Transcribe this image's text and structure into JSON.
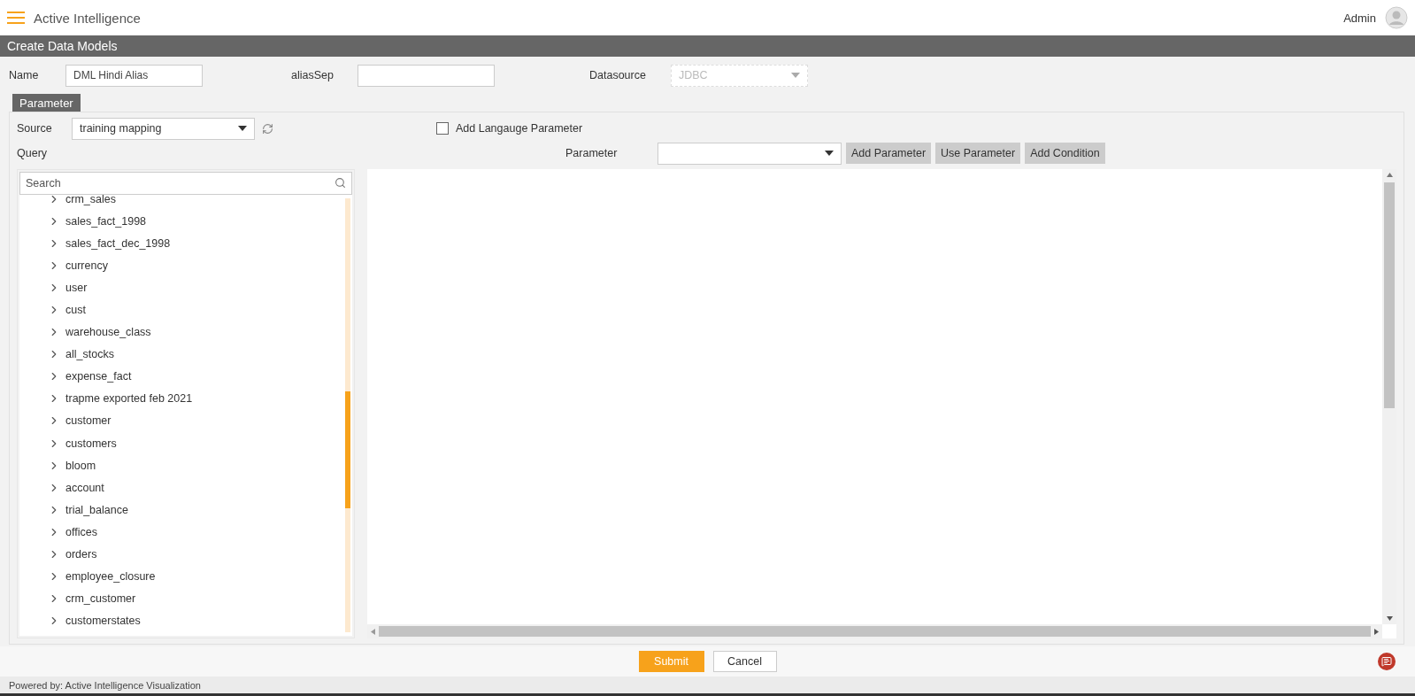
{
  "header": {
    "app_title": "Active Intelligence",
    "user": "Admin"
  },
  "page_title": "Create Data Models",
  "form": {
    "name_label": "Name",
    "name_value": "DML Hindi Alias",
    "alias_label": "aliasSep",
    "datasource_label": "Datasource",
    "datasource_value": "JDBC",
    "datasource_disabled": true
  },
  "tabs": [
    {
      "label": "Parameter",
      "selected": true
    }
  ],
  "source": {
    "label": "Source",
    "value": "training mapping"
  },
  "language_checkbox": {
    "label": "Add Langauge Parameter",
    "checked": false
  },
  "query_label": "Query",
  "parameter": {
    "label": "Parameter"
  },
  "parameter_buttons": [
    "Add Parameter",
    "Use Parameter",
    "Add Condition"
  ],
  "search": {
    "placeholder": "Search"
  },
  "tree": {
    "items": [
      {
        "label": "crm_sales",
        "expanded": false
      },
      {
        "label": "sales_fact_1998",
        "expanded": false
      },
      {
        "label": "sales_fact_dec_1998",
        "expanded": false
      },
      {
        "label": "currency",
        "expanded": false
      },
      {
        "label": "user",
        "expanded": false
      },
      {
        "label": "cust",
        "expanded": false
      },
      {
        "label": "warehouse_class",
        "expanded": false
      },
      {
        "label": "all_stocks",
        "expanded": false
      },
      {
        "label": "expense_fact",
        "expanded": false
      },
      {
        "label": "trapme exported feb 2021",
        "expanded": false
      },
      {
        "label": "customer",
        "expanded": false
      },
      {
        "label": "customers",
        "expanded": false
      },
      {
        "label": "bloom",
        "expanded": false
      },
      {
        "label": "account",
        "expanded": false
      },
      {
        "label": "trial_balance",
        "expanded": false
      },
      {
        "label": "offices",
        "expanded": false
      },
      {
        "label": "orders",
        "expanded": false
      },
      {
        "label": "employee_closure",
        "expanded": false
      },
      {
        "label": "crm_customer",
        "expanded": false
      },
      {
        "label": "customerstates",
        "expanded": false
      }
    ]
  },
  "actions": [
    {
      "label": "Submit",
      "kind": "primary"
    },
    {
      "label": "Cancel",
      "kind": "secondary"
    }
  ],
  "footer": "Powered by: Active Intelligence Visualization"
}
